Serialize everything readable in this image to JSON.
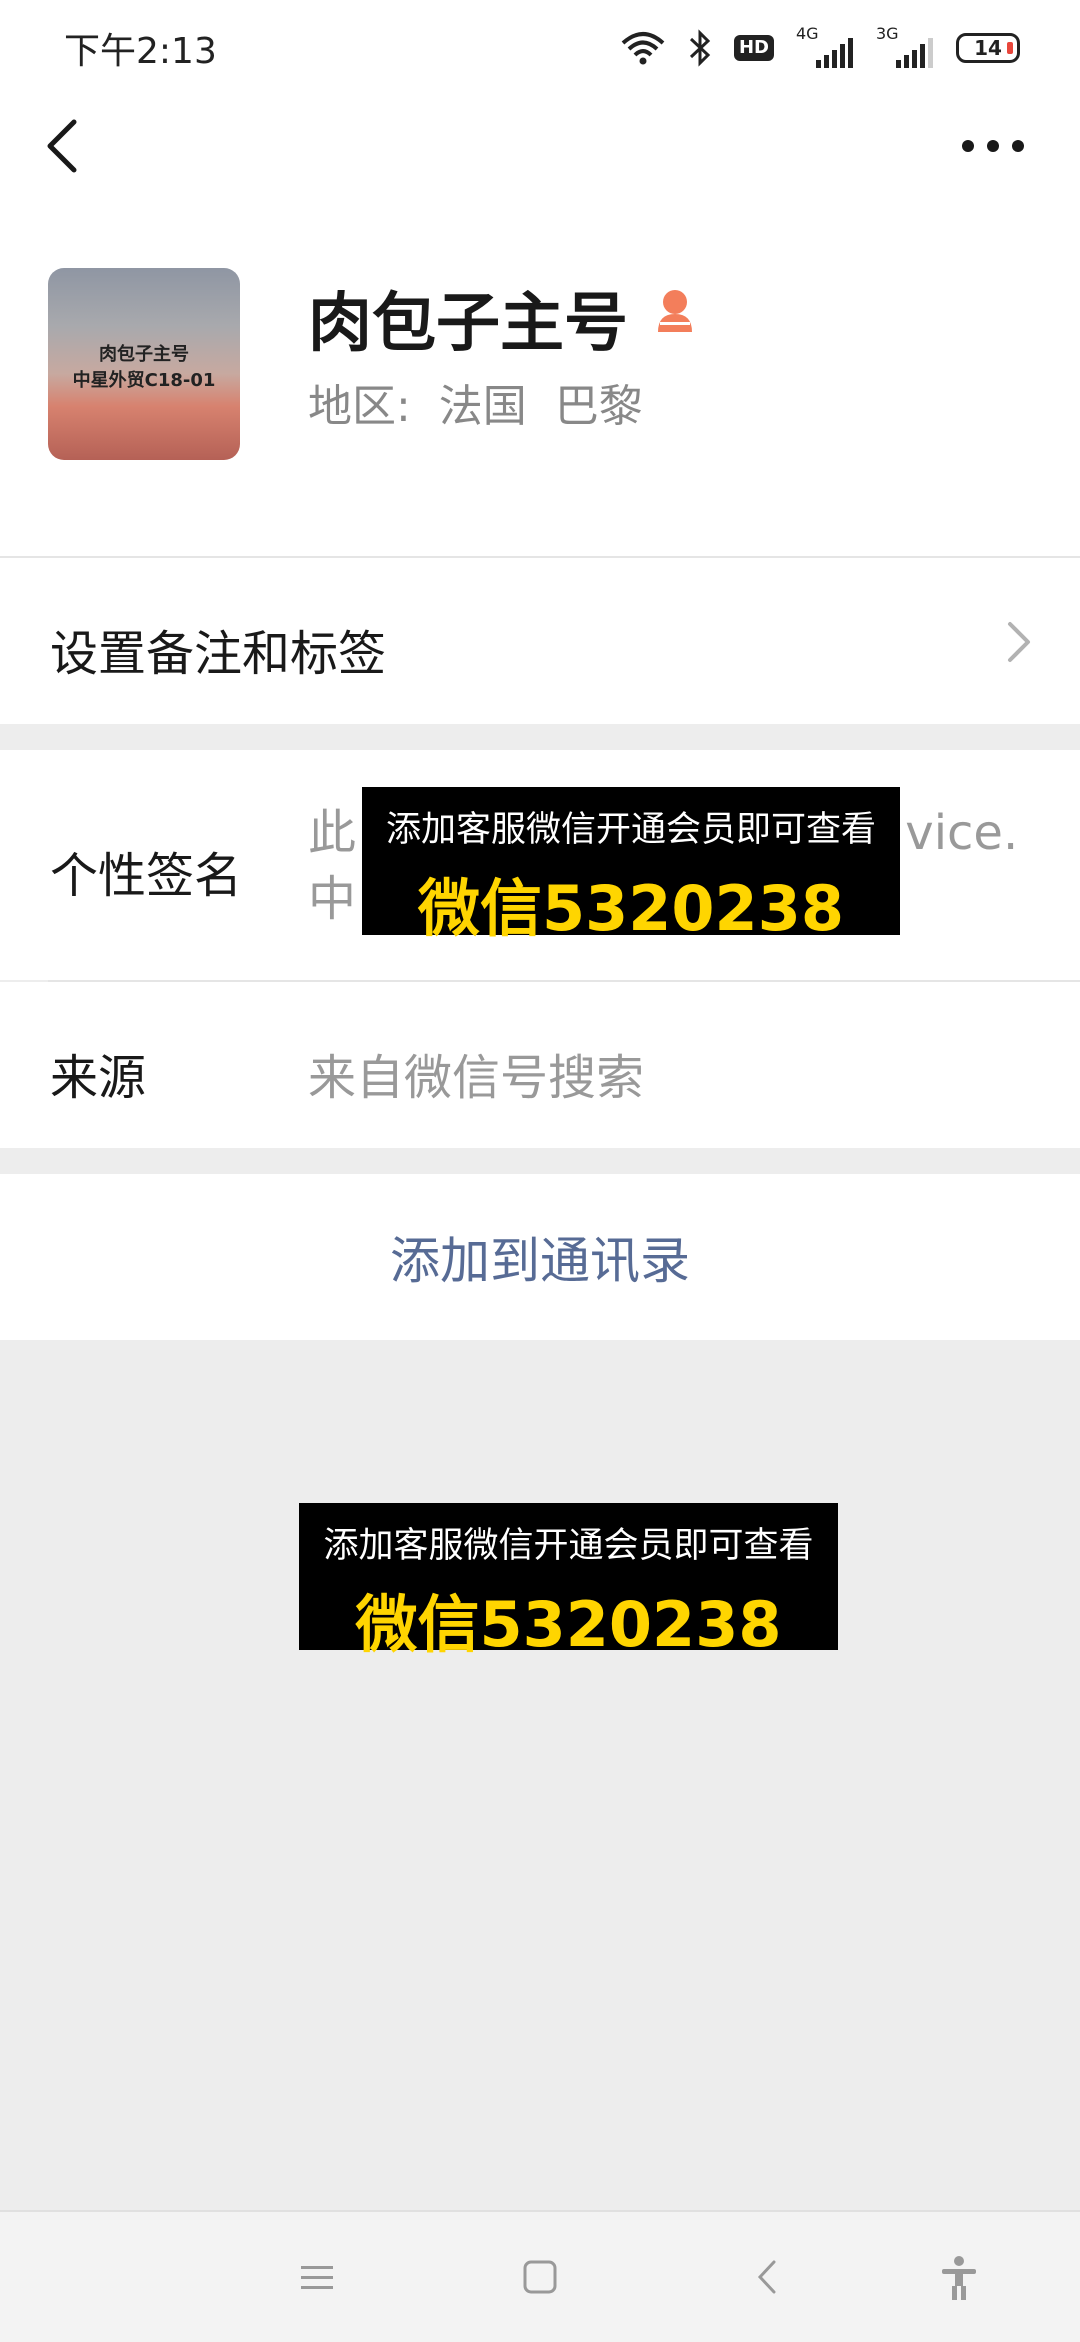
{
  "status_bar": {
    "time": "下午2:13",
    "hd": "HD",
    "net1": "4G",
    "net2": "3G",
    "battery": "14",
    "icons": [
      "wifi-icon",
      "bluetooth-icon",
      "hd-icon",
      "signal-4g-icon",
      "signal-3g-icon",
      "battery-icon"
    ]
  },
  "header": {
    "back_icon": "back-arrow-icon",
    "more_icon": "more-dots-icon"
  },
  "profile": {
    "avatar_text_line1": "肉包子主号",
    "avatar_text_line2": "中星外贸C18-01",
    "name": "肉包子主号",
    "gender_icon": "female-gender-icon",
    "gender_color": "#f37e5b",
    "region": "地区:  法国  巴黎"
  },
  "remark": {
    "label": "设置备注和标签"
  },
  "signature": {
    "label": "个性签名",
    "value": "此                                    vice.\n中"
  },
  "source": {
    "label": "来源",
    "value": "来自微信号搜索"
  },
  "actions": {
    "add_contact": "添加到通讯录",
    "link_color": "#576b95"
  },
  "promo": {
    "line1": "添加客服微信开通会员即可查看",
    "line2": "微信5320238",
    "accent": "#ffd500"
  },
  "nav_bar": {
    "icons": [
      "menu-icon",
      "home-square-icon",
      "back-chevron-icon",
      "accessibility-icon"
    ]
  }
}
